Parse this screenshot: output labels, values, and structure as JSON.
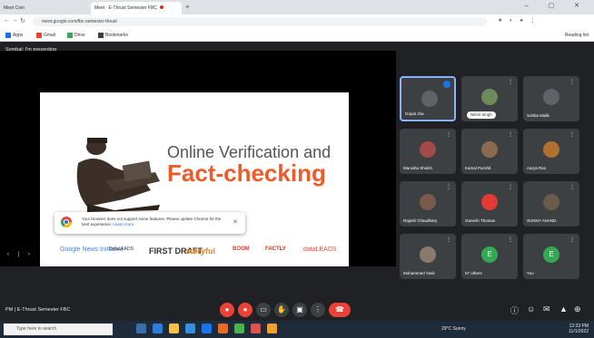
{
  "browser": {
    "tabs": [
      {
        "label": "Meet Coin"
      },
      {
        "label": "Meet · E-Thrust Semester FBC"
      }
    ],
    "new_tab_label": "+",
    "window_buttons": "– ▢ ✕",
    "url": "meet.google.com/fbc-semester-thrust",
    "bookmarks": [
      {
        "label": "Apps"
      },
      {
        "label": "Gmail"
      },
      {
        "label": "Drive"
      },
      {
        "label": "Bookmarks"
      }
    ],
    "reading_list_label": "Reading list"
  },
  "meet": {
    "presenting_banner": "Sombal: I'm presenting",
    "slide": {
      "title_line1": "Online Verification and",
      "title_line2": "Fact-checking"
    },
    "notice": {
      "text": "Your browser does not support some features. Please update Chrome for the best experience.",
      "link": "Learn more"
    },
    "logos": [
      "Google News Initiative",
      "DataLEADS",
      "FIRST DRAFT",
      "storyful",
      "BOOM",
      "FACTLY",
      "dataLEADS"
    ],
    "participants": [
      {
        "name": "Gopal Jha",
        "active": true,
        "color": "#5f6368"
      },
      {
        "name": "Nikhil Singh",
        "pill": true,
        "color": "#6d8b5a"
      },
      {
        "name": "Sohba Malik",
        "color": "#5f6368"
      },
      {
        "name": "Manisha Sheikh",
        "color": "#a14a4a"
      },
      {
        "name": "Kamal Purohit",
        "color": "#8a6a50"
      },
      {
        "name": "Aarya Rao",
        "color": "#b07030"
      },
      {
        "name": "Rajesh Chaudhary",
        "color": "#7a5a4a"
      },
      {
        "name": "Ganesh Thomas",
        "color": "#e53935"
      },
      {
        "name": "SUNNY ANAND",
        "color": "#6a5a4a"
      },
      {
        "name": "Mohammed Yasir",
        "color": "#8a7a6a"
      },
      {
        "name": "57 others",
        "color": "#34a853"
      },
      {
        "name": "You",
        "color": "#34a853"
      }
    ],
    "others_initials": "E",
    "you_initial": "E",
    "meeting_label": "PM | E-Thrust Semester FBC",
    "controls": [
      "mic-off",
      "camera-off",
      "captions",
      "hand",
      "present",
      "more",
      "end-call"
    ]
  },
  "taskbar": {
    "search_placeholder": "Type here to search",
    "weather": "29°C Sunny",
    "time": "12:33 PM",
    "date": "11/1/2022"
  }
}
